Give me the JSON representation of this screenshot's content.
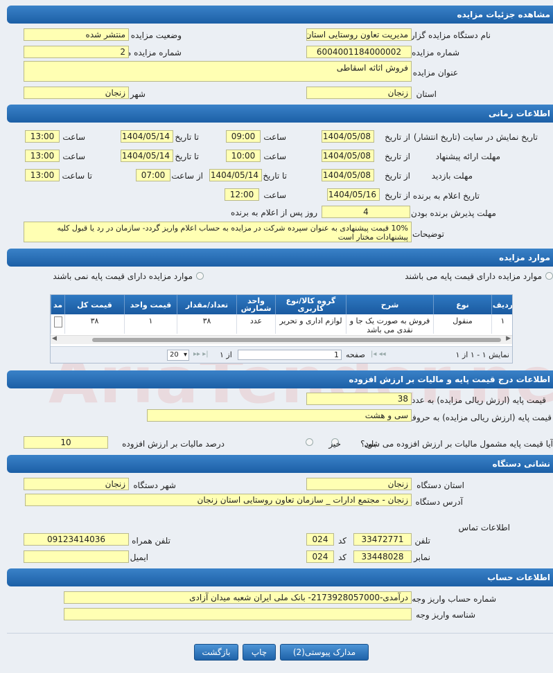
{
  "sections": {
    "details": "مشاهده جزئیات مزایده",
    "timing": "اطلاعات زمانی",
    "items": "موارد مزایده",
    "base_price": "اطلاعات درج قیمت پایه و مالیات بر ارزش افزوده",
    "agency": "نشانی دستگاه",
    "account": "اطلاعات حساب"
  },
  "details": {
    "org_label": "نام دستگاه مزایده گزار",
    "org_value": "مدیریت تعاون روستایی استان زنجان",
    "status_label": "وضعیت مزایده",
    "status_value": "منتشر شده",
    "number_label": "شماره مزایده",
    "number_value": "6004001184000002",
    "ref_label": "شماره مزایده مرجع",
    "ref_value": "2",
    "title_label": "عنوان مزایده",
    "title_value": "فروش اثاثه اسقاطی",
    "province_label": "استان",
    "province_value": "زنجان",
    "city_label": "شهر",
    "city_value": "زنجان"
  },
  "timing": {
    "display_label": "تاریخ نمایش در سایت (تاریخ انتشار)",
    "from_date": "از تاریخ",
    "to_date": "تا تاریخ",
    "time": "ساعت",
    "from_time": "از ساعت",
    "to_time": "تا ساعت",
    "display_from": "1404/05/08",
    "display_from_time": "09:00",
    "display_to": "1404/05/14",
    "display_to_time": "13:00",
    "offer_label": "مهلت ارائه پیشنهاد",
    "offer_from": "1404/05/08",
    "offer_from_time": "10:00",
    "offer_to": "1404/05/14",
    "offer_to_time": "13:00",
    "visit_label": "مهلت بازدید",
    "visit_from": "1404/05/08",
    "visit_to": "1404/05/14",
    "visit_from_time": "07:00",
    "visit_to_time": "13:00",
    "winner_label": "تاریخ اعلام به برنده",
    "winner_date": "1404/05/16",
    "winner_time": "12:00",
    "accept_label": "مهلت پذیرش برنده بودن",
    "accept_value": "4",
    "accept_suffix": "روز پس از اعلام به برنده",
    "desc_label": "توضیحات",
    "desc_value": "10% قیمت پیشنهادی به عنوان سپرده شرکت در مزایده به حساب اعلام واریز گردد- سازمان در رد یا قبول کلیه پیشنهادات مختار است"
  },
  "items": {
    "radio_with_price": "موارد مزایده دارای قیمت پایه می باشند",
    "radio_without_price": "موارد مزایده دارای قیمت پایه نمی باشند",
    "columns": [
      "ردیف",
      "نوع",
      "شرح",
      "گروه کالا/نوع کاربری",
      "واحد شمارش",
      "تعداد/مقدار",
      "قیمت واحد",
      "قیمت کل",
      "مد"
    ],
    "rows": [
      {
        "index": "۱",
        "type": "منقول",
        "desc": "فروش به صورت یک جا و نقدی می باشد",
        "group": "لوازم اداری و تحریر",
        "unit": "عدد",
        "qty": "۳۸",
        "unit_price": "۱",
        "total": "۳۸"
      }
    ],
    "pager": {
      "showing": "نمایش ۱ - ۱ از ۱",
      "page_label": "صفحه",
      "page_value": "1",
      "of_label": "از ۱",
      "page_size": "20"
    }
  },
  "base_price": {
    "numeric_label": "قیمت پایه (ارزش ریالی مزایده) به عدد",
    "numeric_value": "38",
    "words_label": "قیمت پایه (ارزش ریالی مزایده) به حروف",
    "words_value": "سی و هشت",
    "vat_question": "آیا قیمت پایه مشمول مالیات بر ارزش افزوده می شود؟",
    "yes": "بلی",
    "no": "خیر",
    "vat_pct_label": "درصد مالیات بر ارزش افزوده",
    "vat_pct_value": "10"
  },
  "agency": {
    "province_label": "استان دستگاه",
    "province_value": "زنجان",
    "city_label": "شهر دستگاه",
    "city_value": "زنجان",
    "address_label": "آدرس دستگاه",
    "address_value": "زنجان - مجتمع ادارات _ سازمان تعاون روستایی استان زنجان",
    "contact_label": "اطلاعات تماس",
    "phone_label": "تلفن",
    "phone_value": "33472771",
    "code_label": "کد",
    "phone_code": "024",
    "mobile_label": "تلفن همراه",
    "mobile_value": "09123414036",
    "fax_label": "نمابر",
    "fax_value": "33448028",
    "fax_code": "024",
    "email_label": "ایمیل",
    "email_value": ""
  },
  "account": {
    "deposit_label": "شماره حساب واریز وجه",
    "deposit_value": "درآمدی-2173928057000- بانک ملی ایران شعبه میدان آزادی",
    "id_label": "شناسه واریز وجه",
    "id_value": ""
  },
  "buttons": {
    "attachments": "مدارک پیوستی(2)",
    "print": "چاپ",
    "back": "بازگشت"
  },
  "watermark": "AriaTender.net"
}
